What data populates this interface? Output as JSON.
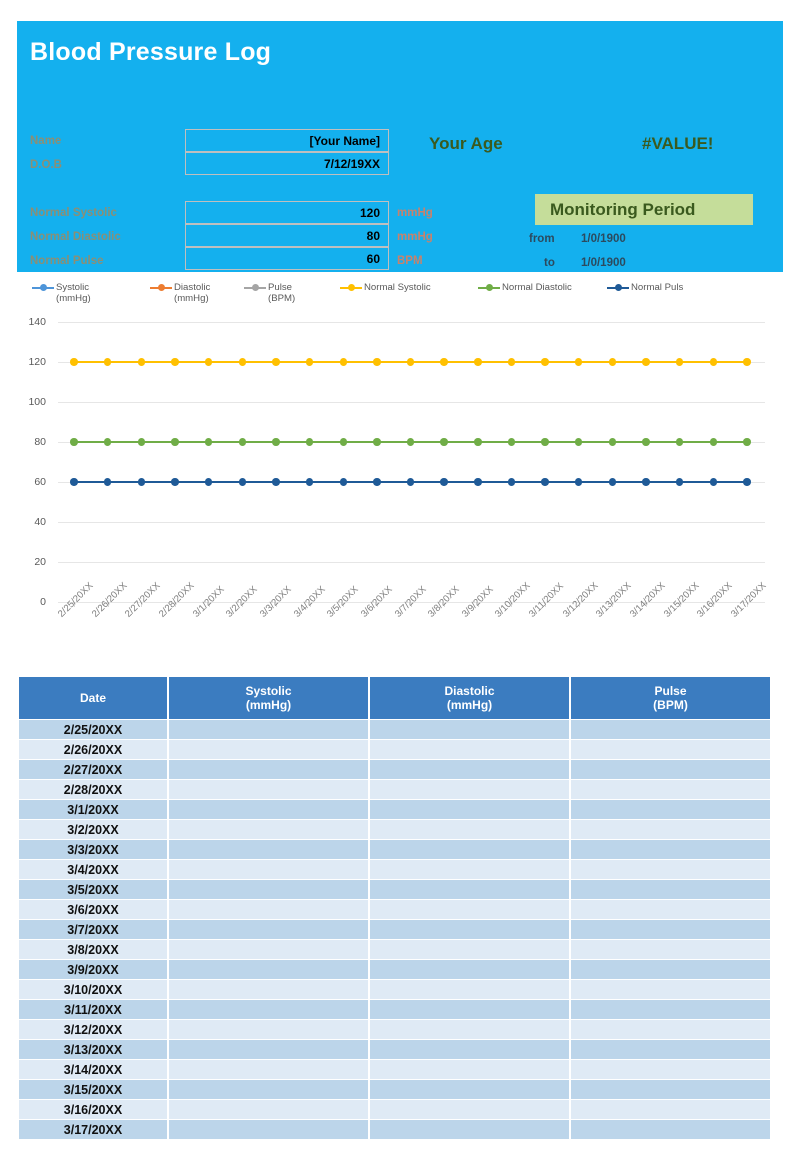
{
  "header": {
    "title": "Blood Pressure Log",
    "panel_color": "#14B0EE",
    "fields": [
      {
        "label": "Name",
        "value": "[Your Name]",
        "unit": ""
      },
      {
        "label": "D.O.B",
        "value": "7/12/19XX",
        "unit": ""
      },
      {
        "label": "Normal Systolic",
        "value": "120",
        "unit": "mmHg"
      },
      {
        "label": "Normal Diastolic",
        "value": "80",
        "unit": "mmHg"
      },
      {
        "label": "Normal Pulse",
        "value": "60",
        "unit": "BPM"
      }
    ],
    "age_label": "Your Age",
    "age_value": "#VALUE!",
    "monitoring": {
      "title": "Monitoring Period",
      "title_bg": "#C5DD9A",
      "from_label": "from",
      "from_value": "1/0/1900",
      "to_label": "to",
      "to_value": "1/0/1900"
    }
  },
  "chart_data": {
    "type": "line",
    "title": "",
    "xlabel": "",
    "ylabel": "",
    "ylim": [
      0,
      140
    ],
    "yticks": [
      0,
      20,
      40,
      60,
      80,
      100,
      120,
      140
    ],
    "grid": true,
    "legend_position": "top",
    "categories": [
      "2/25/20XX",
      "2/26/20XX",
      "2/27/20XX",
      "2/28/20XX",
      "3/1/20XX",
      "3/2/20XX",
      "3/3/20XX",
      "3/4/20XX",
      "3/5/20XX",
      "3/6/20XX",
      "3/7/20XX",
      "3/8/20XX",
      "3/9/20XX",
      "3/10/20XX",
      "3/11/20XX",
      "3/12/20XX",
      "3/13/20XX",
      "3/14/20XX",
      "3/15/20XX",
      "3/16/20XX",
      "3/17/20XX"
    ],
    "series": [
      {
        "name": "Systolic",
        "sub": "(mmHg)",
        "color": "#4E95D9",
        "values": [
          null,
          null,
          null,
          null,
          null,
          null,
          null,
          null,
          null,
          null,
          null,
          null,
          null,
          null,
          null,
          null,
          null,
          null,
          null,
          null,
          null
        ]
      },
      {
        "name": "Diastolic",
        "sub": "(mmHg)",
        "color": "#ED7D31",
        "values": [
          null,
          null,
          null,
          null,
          null,
          null,
          null,
          null,
          null,
          null,
          null,
          null,
          null,
          null,
          null,
          null,
          null,
          null,
          null,
          null,
          null
        ]
      },
      {
        "name": "Pulse",
        "sub": "(BPM)",
        "color": "#A5A5A5",
        "values": [
          null,
          null,
          null,
          null,
          null,
          null,
          null,
          null,
          null,
          null,
          null,
          null,
          null,
          null,
          null,
          null,
          null,
          null,
          null,
          null,
          null
        ]
      },
      {
        "name": "Normal Systolic",
        "sub": "",
        "color": "#FFC000",
        "values": [
          120,
          120,
          120,
          120,
          120,
          120,
          120,
          120,
          120,
          120,
          120,
          120,
          120,
          120,
          120,
          120,
          120,
          120,
          120,
          120,
          120
        ]
      },
      {
        "name": "Normal Diastolic",
        "sub": "",
        "color": "#70AD47",
        "values": [
          80,
          80,
          80,
          80,
          80,
          80,
          80,
          80,
          80,
          80,
          80,
          80,
          80,
          80,
          80,
          80,
          80,
          80,
          80,
          80,
          80
        ]
      },
      {
        "name": "Normal Puls",
        "sub": "",
        "color": "#1F5A97",
        "values": [
          60,
          60,
          60,
          60,
          60,
          60,
          60,
          60,
          60,
          60,
          60,
          60,
          60,
          60,
          60,
          60,
          60,
          60,
          60,
          60,
          60
        ]
      }
    ]
  },
  "table": {
    "header_color": "#3B7CC0",
    "columns": [
      {
        "label": "Date",
        "sub": ""
      },
      {
        "label": "Systolic",
        "sub": "(mmHg)"
      },
      {
        "label": "Diastolic",
        "sub": "(mmHg)"
      },
      {
        "label": "Pulse",
        "sub": "(BPM)"
      }
    ],
    "rows": [
      {
        "date": "2/25/20XX",
        "systolic": "",
        "diastolic": "",
        "pulse": ""
      },
      {
        "date": "2/26/20XX",
        "systolic": "",
        "diastolic": "",
        "pulse": ""
      },
      {
        "date": "2/27/20XX",
        "systolic": "",
        "diastolic": "",
        "pulse": ""
      },
      {
        "date": "2/28/20XX",
        "systolic": "",
        "diastolic": "",
        "pulse": ""
      },
      {
        "date": "3/1/20XX",
        "systolic": "",
        "diastolic": "",
        "pulse": ""
      },
      {
        "date": "3/2/20XX",
        "systolic": "",
        "diastolic": "",
        "pulse": ""
      },
      {
        "date": "3/3/20XX",
        "systolic": "",
        "diastolic": "",
        "pulse": ""
      },
      {
        "date": "3/4/20XX",
        "systolic": "",
        "diastolic": "",
        "pulse": ""
      },
      {
        "date": "3/5/20XX",
        "systolic": "",
        "diastolic": "",
        "pulse": ""
      },
      {
        "date": "3/6/20XX",
        "systolic": "",
        "diastolic": "",
        "pulse": ""
      },
      {
        "date": "3/7/20XX",
        "systolic": "",
        "diastolic": "",
        "pulse": ""
      },
      {
        "date": "3/8/20XX",
        "systolic": "",
        "diastolic": "",
        "pulse": ""
      },
      {
        "date": "3/9/20XX",
        "systolic": "",
        "diastolic": "",
        "pulse": ""
      },
      {
        "date": "3/10/20XX",
        "systolic": "",
        "diastolic": "",
        "pulse": ""
      },
      {
        "date": "3/11/20XX",
        "systolic": "",
        "diastolic": "",
        "pulse": ""
      },
      {
        "date": "3/12/20XX",
        "systolic": "",
        "diastolic": "",
        "pulse": ""
      },
      {
        "date": "3/13/20XX",
        "systolic": "",
        "diastolic": "",
        "pulse": ""
      },
      {
        "date": "3/14/20XX",
        "systolic": "",
        "diastolic": "",
        "pulse": ""
      },
      {
        "date": "3/15/20XX",
        "systolic": "",
        "diastolic": "",
        "pulse": ""
      },
      {
        "date": "3/16/20XX",
        "systolic": "",
        "diastolic": "",
        "pulse": ""
      },
      {
        "date": "3/17/20XX",
        "systolic": "",
        "diastolic": "",
        "pulse": ""
      }
    ]
  }
}
